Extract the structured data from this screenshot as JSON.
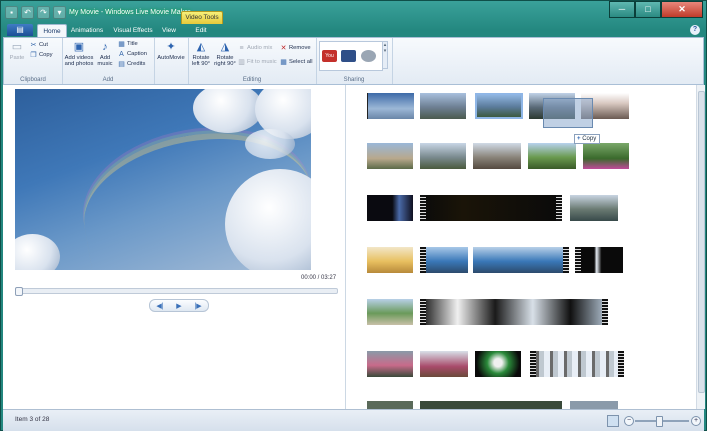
{
  "window": {
    "title": "My Movie - Windows Live Movie Maker",
    "context_tab": "Video Tools",
    "minimize_glyph": "─",
    "maximize_glyph": "□",
    "close_glyph": "✕"
  },
  "qat": {
    "save_glyph": "▪",
    "undo_glyph": "↶",
    "redo_glyph": "↷",
    "more_glyph": "▾"
  },
  "app_button_glyph": "▤",
  "help_glyph": "?",
  "tabs": [
    {
      "label": "Home",
      "active": true
    },
    {
      "label": "Animations",
      "active": false
    },
    {
      "label": "Visual Effects",
      "active": false
    },
    {
      "label": "View",
      "active": false
    },
    {
      "label": "Edit",
      "active": false
    }
  ],
  "ribbon": {
    "clipboard": {
      "label": "Clipboard",
      "paste": "Paste",
      "cut": "Cut",
      "copy": "Copy"
    },
    "add": {
      "label": "Add",
      "add_videos": "Add videos",
      "add_videos_2": "and photos",
      "add_music": "Add",
      "add_music_2": "music",
      "title": "Title",
      "caption": "Caption",
      "credits": "Credits"
    },
    "automovie": {
      "label": "AutoMovie"
    },
    "editing": {
      "label": "Editing",
      "rotate_left": "Rotate",
      "rotate_left_2": "left 90°",
      "rotate_right": "Rotate",
      "rotate_right_2": "right 90°",
      "audio_mix": "Audio mix",
      "fit_to_music": "Fit to music",
      "remove": "Remove",
      "select_all": "Select all"
    },
    "sharing": {
      "label": "Sharing",
      "youtube": "You Tube"
    }
  },
  "preview": {
    "time": "00:00 / 03:27",
    "prev_glyph": "◀|",
    "play_glyph": "▶",
    "next_glyph": "|▶"
  },
  "storyboard": {
    "copy_tooltip": "Copy",
    "copy_glyph": "+"
  },
  "status": {
    "text": "Item 3 of 28",
    "zoom_out_glyph": "−",
    "zoom_in_glyph": "+",
    "zoom_level": 0.45
  },
  "colors": {
    "accent": "#2d64b0",
    "chrome": "#23877f"
  }
}
